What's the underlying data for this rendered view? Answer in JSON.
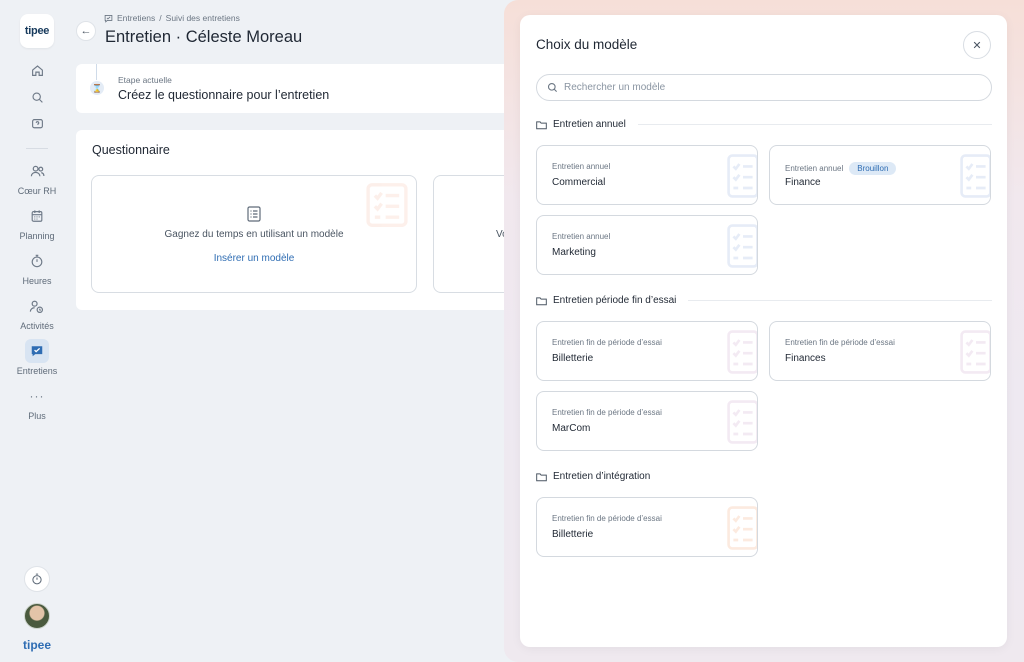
{
  "sidebar": {
    "logo": "tipee",
    "items": [
      {
        "label": "Cœur RH",
        "icon": "people-icon"
      },
      {
        "label": "Planning",
        "icon": "calendar-icon"
      },
      {
        "label": "Heures",
        "icon": "stopwatch-icon"
      },
      {
        "label": "Activités",
        "icon": "activity-icon"
      },
      {
        "label": "Entretiens",
        "icon": "interview-icon",
        "active": true
      },
      {
        "label": "Plus",
        "icon": "more-icon"
      }
    ],
    "bottom_logo": "tipee"
  },
  "header": {
    "breadcrumb": [
      "Entretiens",
      "Suivi des entretiens"
    ],
    "breadcrumb_separator": "/",
    "title": "Entretien · Céleste Moreau"
  },
  "step": {
    "label": "Etape actuelle",
    "text": "Créez le questionnaire pour l’entretien"
  },
  "questionnaire": {
    "title": "Questionnaire",
    "option1_text": "Gagnez du temps en utilisant un modèle",
    "option1_link": "Insérer un modèle",
    "option2_text": "Vo"
  },
  "drawer": {
    "title": "Choix du modèle",
    "search_placeholder": "Rechercher un modèle",
    "groups": [
      {
        "title": "Entretien annuel",
        "templates": [
          {
            "type": "Entretien annuel",
            "name": "Commercial",
            "badge": ""
          },
          {
            "type": "Entretien annuel",
            "name": "Finance",
            "badge": "Brouillon"
          },
          {
            "type": "Entretien annuel",
            "name": "Marketing",
            "badge": ""
          }
        ]
      },
      {
        "title": "Entretien période fin d’essai",
        "templates": [
          {
            "type": "Entretien fin de période d’essai",
            "name": "Billetterie",
            "badge": ""
          },
          {
            "type": "Entretien fin de période d’essai",
            "name": "Finances",
            "badge": ""
          },
          {
            "type": "Entretien fin de période d’essai",
            "name": "MarCom",
            "badge": ""
          }
        ]
      },
      {
        "title": "Entretien d’intégration",
        "templates": [
          {
            "type": "Entretien fin de période d’essai",
            "name": "Billetterie",
            "badge": ""
          }
        ]
      }
    ]
  },
  "colors": {
    "accent": "#2f6db3",
    "background": "#eef1f5",
    "badge_bg": "#dde9f6"
  }
}
